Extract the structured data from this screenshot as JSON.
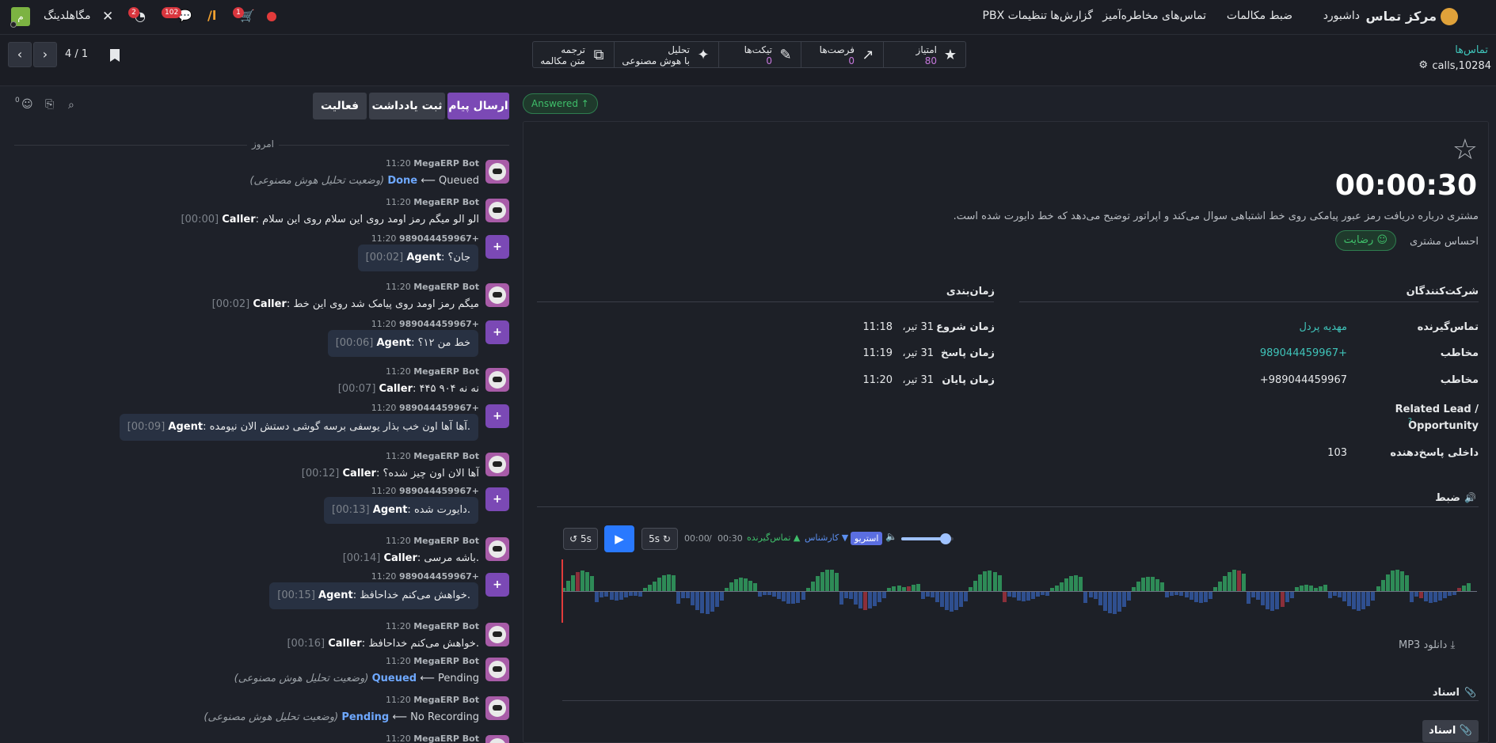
{
  "topbar": {
    "brand": "مرکز تماس",
    "menu": [
      "داشبورد",
      "ضبط مکالمات",
      "تماس‌های مخاطره‌آمیز",
      "گزارش‌ها",
      "تنظیمات PBX"
    ],
    "company": "مگاهلدینگ",
    "company_initial": "م",
    "badges": {
      "activity": "2",
      "messages": "102",
      "cart": "1"
    }
  },
  "breadcrumb": {
    "parent": "تماس‌ها",
    "current": "calls,10284"
  },
  "pager": {
    "value": "4 / 1"
  },
  "stats": [
    {
      "label": "امتیاز",
      "value": "80",
      "icon": "star-icon"
    },
    {
      "label": "فرصت‌ها",
      "value": "0",
      "icon": "chart-trend-icon"
    },
    {
      "label": "تیکت‌ها",
      "value": "0",
      "icon": "ticket-icon"
    },
    {
      "label": "تحلیل",
      "sub": "با هوش مصنوعی",
      "icon": "magic-wand-icon"
    },
    {
      "label": "ترجمه",
      "sub": "متن مکالمه",
      "icon": "translate-icon"
    }
  ],
  "status_badge": "Answered",
  "chatter": {
    "send_message": "ارسال پیام",
    "log_note": "ثبت یادداشت",
    "activity": "فعالیت",
    "followers_count": "0",
    "today": "امروز",
    "messages": [
      {
        "kind": "bot",
        "time": "11:20",
        "author": "MegaERP Bot",
        "new": "Done",
        "old": "Queued",
        "note": "(وضعیت تحلیل هوش مصنوعی)"
      },
      {
        "kind": "bot-line",
        "time": "11:20",
        "author": "MegaERP Bot",
        "ts": "[00:00]",
        "who": "Caller",
        "text": ": الو الو میگم رمز اومد روی این سلام روی این سلام"
      },
      {
        "kind": "agent",
        "time": "11:20",
        "author": "989044459967+",
        "ts": "[00:02]",
        "who": "Agent",
        "text": ": جان؟"
      },
      {
        "kind": "bot-line",
        "time": "11:20",
        "author": "MegaERP Bot",
        "ts": "[00:02]",
        "who": "Caller",
        "text": ": میگم رمز اومد روی پیامک شد روی این خط"
      },
      {
        "kind": "agent",
        "time": "11:20",
        "author": "989044459967+",
        "ts": "[00:06]",
        "who": "Agent",
        "text": ": خط من ۱۲؟"
      },
      {
        "kind": "bot-line",
        "time": "11:20",
        "author": "MegaERP Bot",
        "ts": "[00:07]",
        "who": "Caller",
        "text": ": نه نه ۹۰۴ ۴۴۵"
      },
      {
        "kind": "agent",
        "time": "11:20",
        "author": "989044459967+",
        "ts": "[00:09]",
        "who": "Agent",
        "text": ": آها آها اون خب بذار یوسفی برسه گوشی دستش الان نیومده."
      },
      {
        "kind": "bot-line",
        "time": "11:20",
        "author": "MegaERP Bot",
        "ts": "[00:12]",
        "who": "Caller",
        "text": ": آها الان اون چیز شده؟"
      },
      {
        "kind": "agent",
        "time": "11:20",
        "author": "989044459967+",
        "ts": "[00:13]",
        "who": "Agent",
        "text": ": دایورت شده."
      },
      {
        "kind": "bot-line",
        "time": "11:20",
        "author": "MegaERP Bot",
        "ts": "[00:14]",
        "who": "Caller",
        "text": ": باشه مرسی."
      },
      {
        "kind": "agent",
        "time": "11:20",
        "author": "989044459967+",
        "ts": "[00:15]",
        "who": "Agent",
        "text": ": خواهش می‌کنم خداحافظ."
      },
      {
        "kind": "bot-line",
        "time": "11:20",
        "author": "MegaERP Bot",
        "ts": "[00:16]",
        "who": "Caller",
        "text": ": خواهش می‌کنم خداحافظ."
      },
      {
        "kind": "bot",
        "time": "11:20",
        "author": "MegaERP Bot",
        "new": "Queued",
        "old": "Pending",
        "note": "(وضعیت تحلیل هوش مصنوعی)"
      },
      {
        "kind": "bot",
        "time": "11:20",
        "author": "MegaERP Bot",
        "new": "Pending",
        "old": "No Recording",
        "note": "(وضعیت تحلیل هوش مصنوعی)"
      },
      {
        "kind": "bot-partial",
        "time": "11:20",
        "author": "MegaERP Bot"
      }
    ]
  },
  "form": {
    "duration": "00:00:30",
    "summary": "مشتری درباره دریافت رمز عبور پیامکی روی خط اشتباهی سوال می‌کند و اپراتور توضیح می‌دهد که خط دایورت شده است.",
    "sentiment_label": "احساس مشتری",
    "sentiment_value": "رضایت",
    "participants_title": "شرکت‌کنندگان",
    "timing_title": "زمان‌بندی",
    "participants": [
      {
        "label": "تماس‌گیرنده",
        "value": "مهدیه پردل",
        "link": true
      },
      {
        "label": "مخاطب",
        "value": "989044459967+",
        "link": true
      },
      {
        "label": "مخاطب",
        "value": "+989044459967",
        "link": false
      }
    ],
    "related_label_1": "Related Lead /",
    "related_label_2": "Opportunity",
    "related_help": "?",
    "extension_label": "داخلی پاسخ‌دهنده",
    "extension_value": "103",
    "timing": [
      {
        "label": "زمان شروع",
        "date": "31 تیر،",
        "time": "11:18"
      },
      {
        "label": "زمان پاسخ",
        "date": "31 تیر،",
        "time": "11:19"
      },
      {
        "label": "زمان پایان",
        "date": "31 تیر،",
        "time": "11:20"
      }
    ],
    "recording_title": "ضبط",
    "player": {
      "skip_back": "5s",
      "skip_fwd": "5s",
      "current": "00:00",
      "total": "00:30",
      "caller_legend": "تماس‌گیرنده",
      "agent_legend": "کارشناس",
      "stereo": "استریو",
      "volume": 0.85
    },
    "download": "دانلود MP3",
    "docs_title": "اسناد",
    "docs_button": "اسناد",
    "colors": {
      "caller": "#2e8b57",
      "agent": "#2f4f8f",
      "overlap": "#8b2f3a",
      "accent": "#3fc3b9",
      "primary": "#7b49b5"
    }
  }
}
